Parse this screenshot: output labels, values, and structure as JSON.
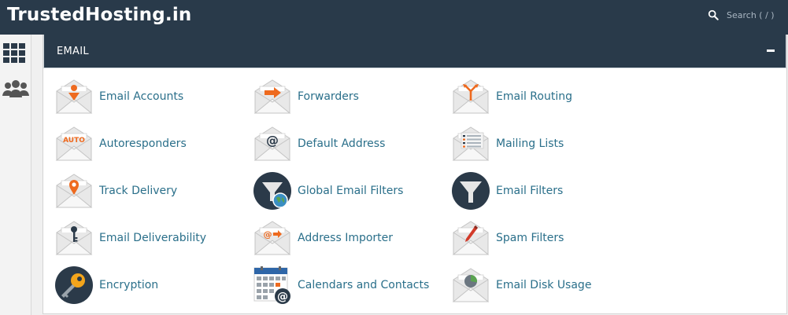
{
  "header": {
    "brand": "TrustedHosting.in",
    "search_placeholder": "Search ( / )"
  },
  "sidebar": {
    "items": [
      {
        "icon": "grid-icon"
      },
      {
        "icon": "users-icon"
      }
    ]
  },
  "panel": {
    "title": "EMAIL",
    "items": [
      {
        "label": "Email Accounts",
        "icon": "envelope-person-icon"
      },
      {
        "label": "Forwarders",
        "icon": "envelope-arrow-icon"
      },
      {
        "label": "Email Routing",
        "icon": "envelope-routing-icon"
      },
      {
        "label": "Autoresponders",
        "icon": "envelope-auto-icon"
      },
      {
        "label": "Default Address",
        "icon": "envelope-at-icon"
      },
      {
        "label": "Mailing Lists",
        "icon": "envelope-list-icon"
      },
      {
        "label": "Track Delivery",
        "icon": "envelope-pin-icon"
      },
      {
        "label": "Global Email Filters",
        "icon": "funnel-globe-icon"
      },
      {
        "label": "Email Filters",
        "icon": "funnel-icon"
      },
      {
        "label": "Email Deliverability",
        "icon": "envelope-key-icon"
      },
      {
        "label": "Address Importer",
        "icon": "envelope-import-icon"
      },
      {
        "label": "Spam Filters",
        "icon": "envelope-pen-icon"
      },
      {
        "label": "Encryption",
        "icon": "key-icon"
      },
      {
        "label": "Calendars and Contacts",
        "icon": "calendar-at-icon"
      },
      {
        "label": "Email Disk Usage",
        "icon": "envelope-pie-icon"
      }
    ]
  },
  "colors": {
    "header_bg": "#293a4a",
    "link": "#2a6f8a",
    "accent_orange": "#ee6a1f"
  }
}
